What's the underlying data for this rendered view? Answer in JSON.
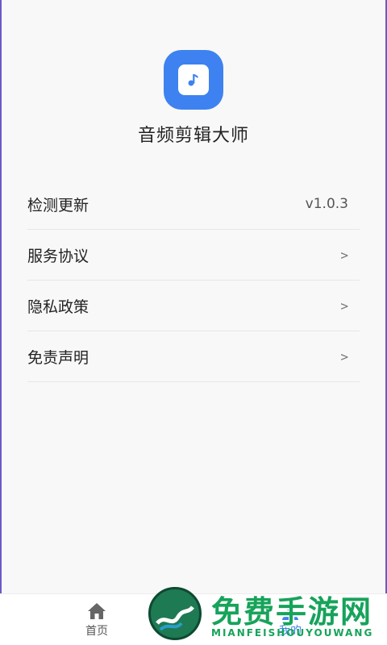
{
  "app": {
    "title": "音频剪辑大师",
    "icon": "music-note-icon",
    "accent_color": "#3d82f0"
  },
  "menu": {
    "items": [
      {
        "label": "检测更新",
        "value": "v1.0.3"
      },
      {
        "label": "服务协议",
        "chevron": ">"
      },
      {
        "label": "隐私政策",
        "chevron": ">"
      },
      {
        "label": "免责声明",
        "chevron": ">"
      }
    ]
  },
  "tabbar": {
    "home": {
      "label": "首页",
      "icon": "home-icon"
    },
    "mine": {
      "label": "我的",
      "icon": "person-icon",
      "active": true
    }
  },
  "watermark": {
    "main": "免费手游网",
    "sub": "MIANFEISHOUYOUWANG"
  }
}
